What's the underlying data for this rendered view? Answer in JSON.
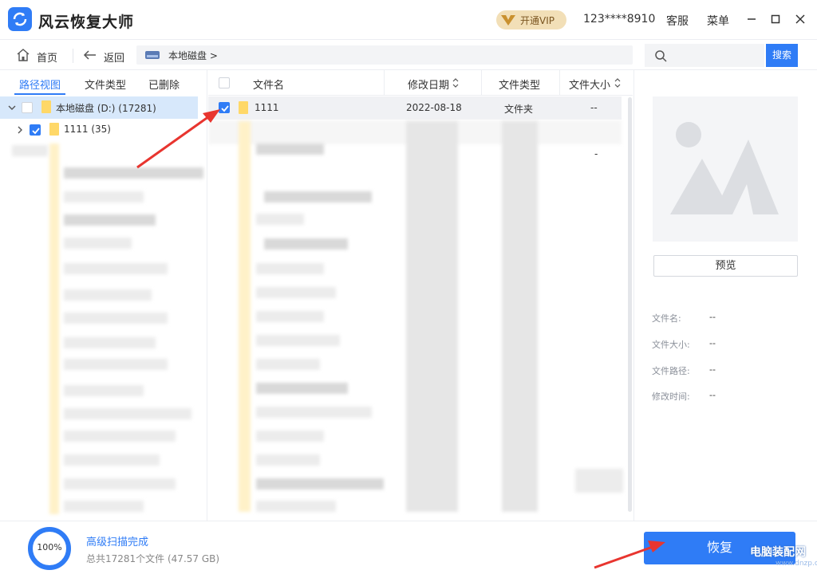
{
  "app": {
    "title": "风云恢复大师",
    "vip_label": "开通VIP",
    "user_phone": "123****8910",
    "service_label": "客服",
    "menu_label": "菜单"
  },
  "nav": {
    "home_label": "首页",
    "back_label": "返回",
    "breadcrumb": "本地磁盘 >",
    "search_placeholder": "",
    "search_button": "搜索"
  },
  "left_tabs": [
    "路径视图",
    "文件类型",
    "已删除"
  ],
  "tree": [
    {
      "label": "本地磁盘 (D:) (17281)",
      "checked": false,
      "expanded": true,
      "selected": true
    },
    {
      "label": "1111 (35)",
      "checked": true,
      "expanded": false,
      "selected": false
    }
  ],
  "table": {
    "headers": {
      "name": "文件名",
      "date": "修改日期",
      "type": "文件类型",
      "size": "文件大小"
    },
    "rows": [
      {
        "name": "1111",
        "date": "2022-08-18",
        "type": "文件夹",
        "size": "--",
        "checked": true
      }
    ],
    "row2_size": "-"
  },
  "preview": {
    "button": "预览",
    "fields": [
      {
        "label": "文件名:",
        "value": "--"
      },
      {
        "label": "文件大小:",
        "value": "--"
      },
      {
        "label": "文件路径:",
        "value": "--"
      },
      {
        "label": "修改时间:",
        "value": "--"
      }
    ]
  },
  "footer": {
    "progress_percent": 100,
    "progress_text": "100%",
    "status": "高级扫描完成",
    "total": "总共17281个文件 (47.57 GB)",
    "recover_button": "恢复",
    "watermark": "电脑装配网",
    "watermark_url": "www.dnzp.com"
  },
  "colors": {
    "accent": "#2f7cf6",
    "vip_bg": "#f2dfb7",
    "annotation_arrow": "#e8352f",
    "folder": "#ffd868"
  }
}
